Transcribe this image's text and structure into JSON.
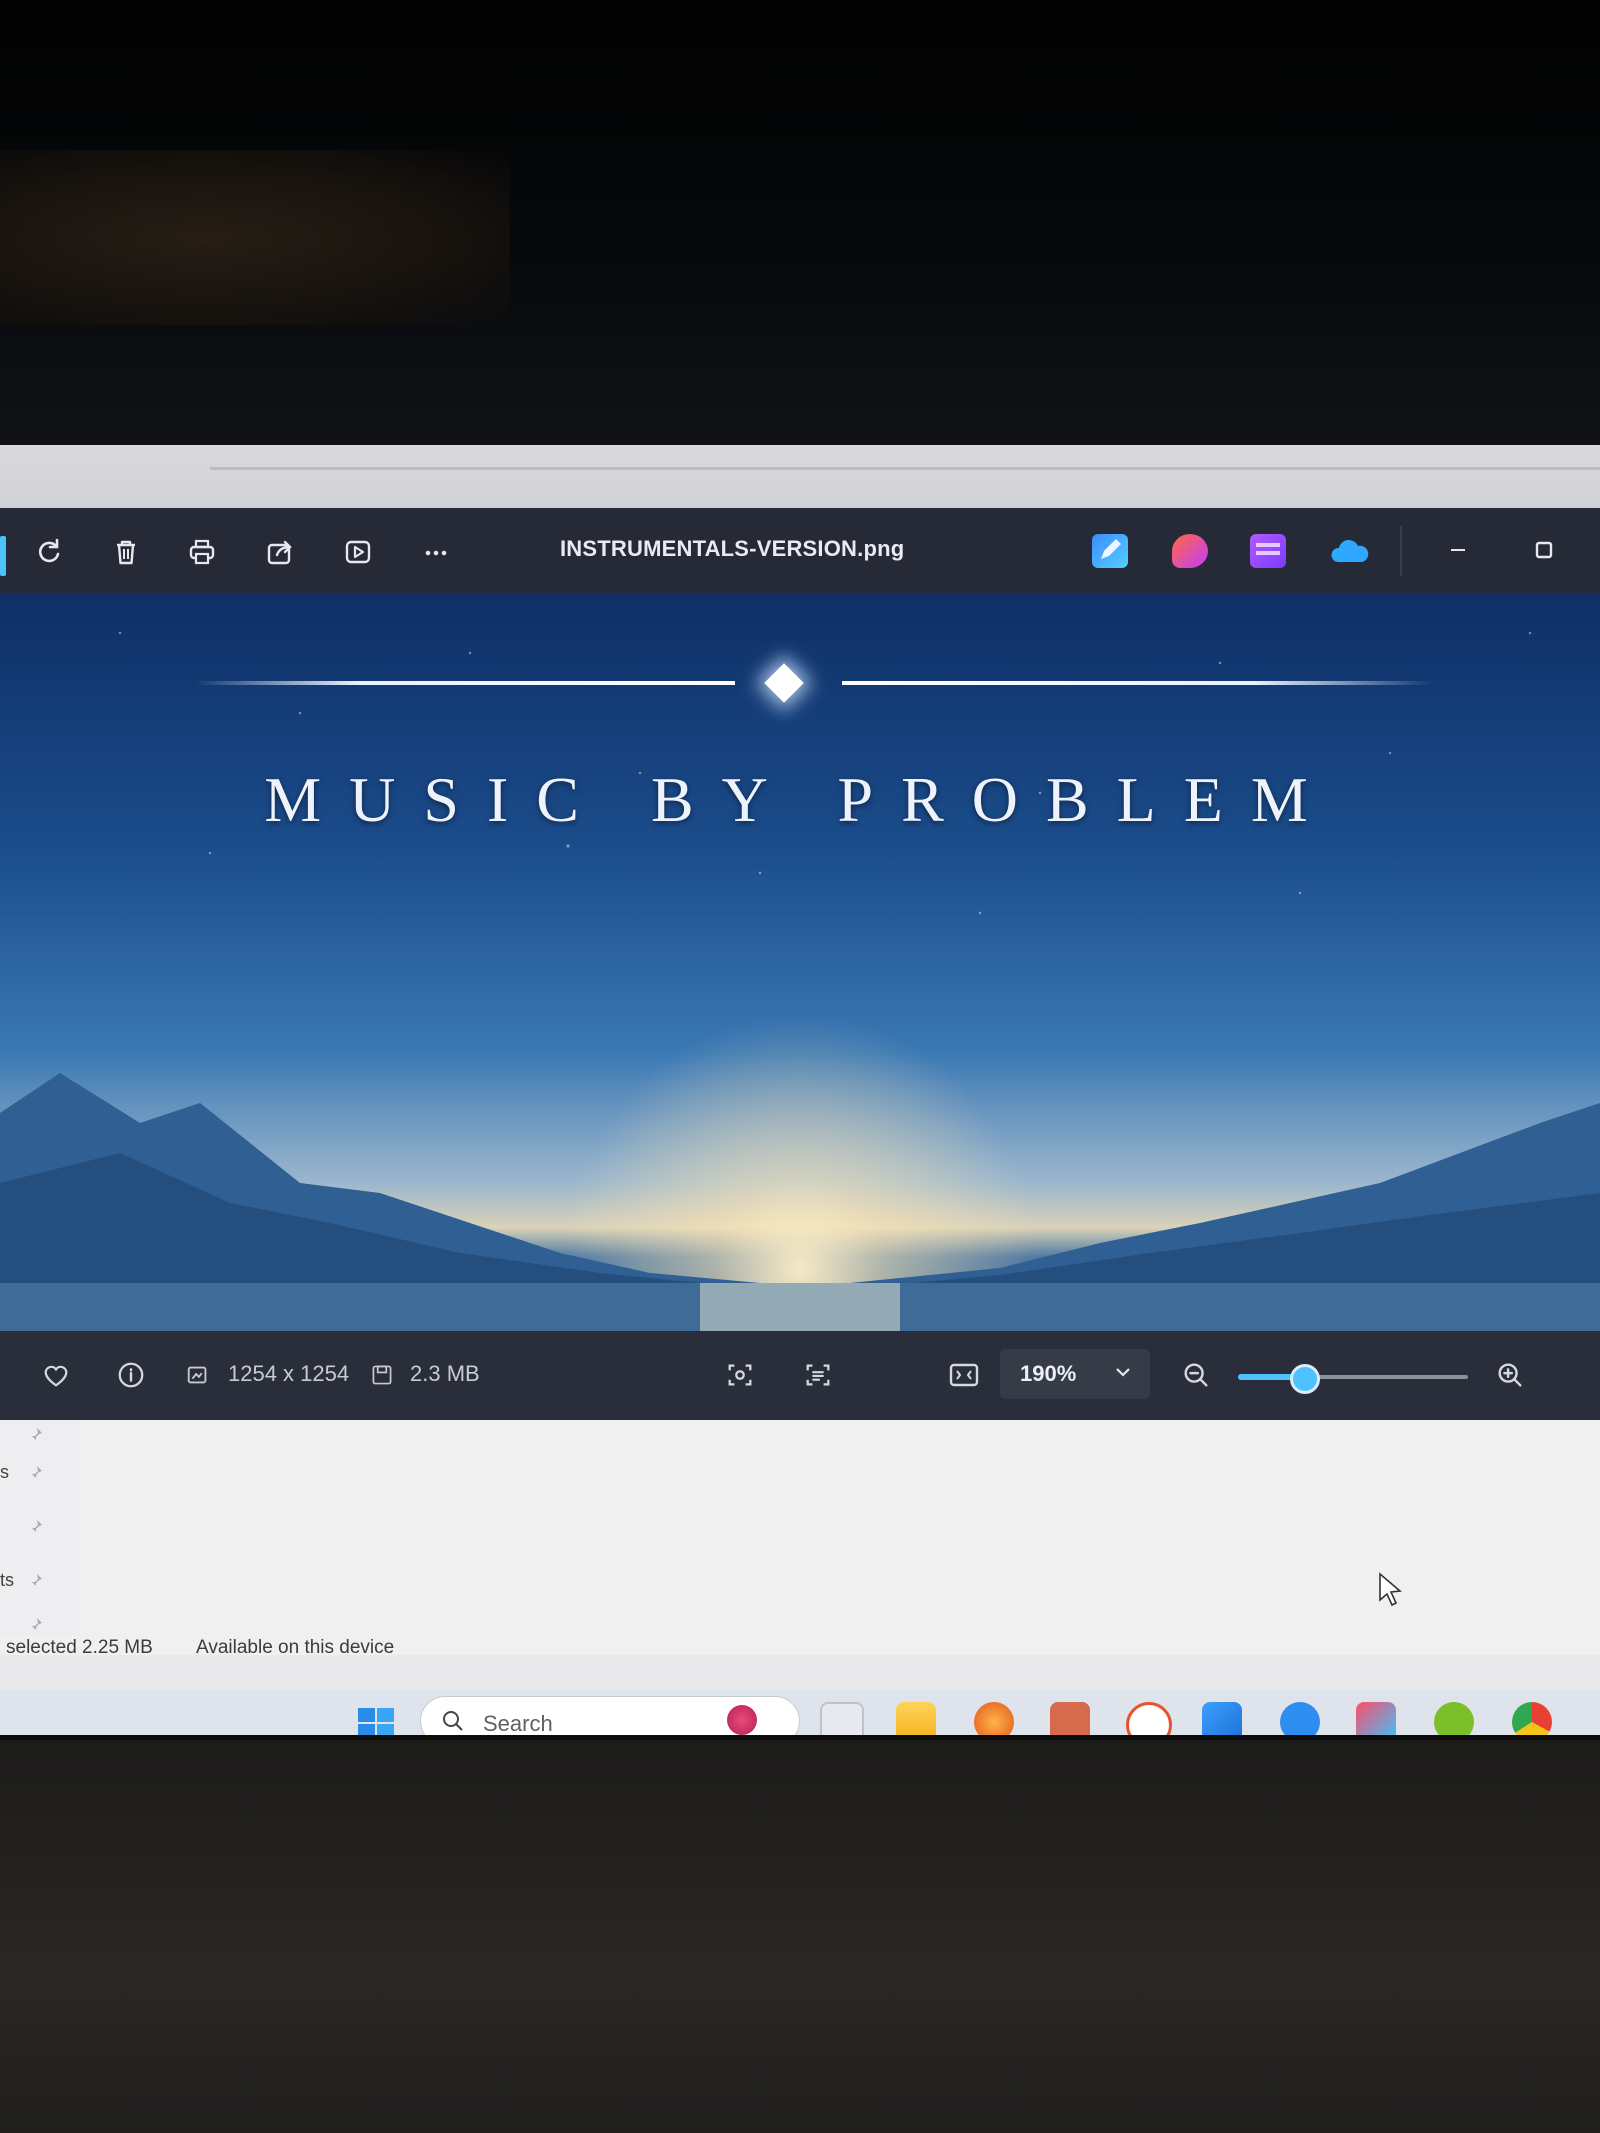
{
  "viewer": {
    "file_name": "INSTRUMENTALS-VERSION.png",
    "toolbar_icons": [
      "rotate-icon",
      "delete-icon",
      "print-icon",
      "share-icon",
      "slideshow-icon",
      "more-icon"
    ],
    "app_icons": [
      "edit-app-icon",
      "clipchamp-icon",
      "video-editor-icon",
      "onedrive-icon"
    ],
    "window_controls": [
      "minimize-icon",
      "maximize-icon"
    ]
  },
  "image": {
    "headline": "MUSIC BY PROBLEM"
  },
  "infobar": {
    "dimensions": "1254 x 1254",
    "file_size": "2.3 MB",
    "zoom": "190%",
    "zoom_level_fraction": 0.28
  },
  "explorer": {
    "nav_fragments": [
      "s",
      "ts"
    ],
    "status_selected": "selected  2.25 MB",
    "status_availability": "Available on this device"
  },
  "taskbar": {
    "search_placeholder": "Search"
  },
  "colors": {
    "accent": "#4cc3ff",
    "titlebar": "#262a36",
    "infobar": "#2a2e3a"
  }
}
